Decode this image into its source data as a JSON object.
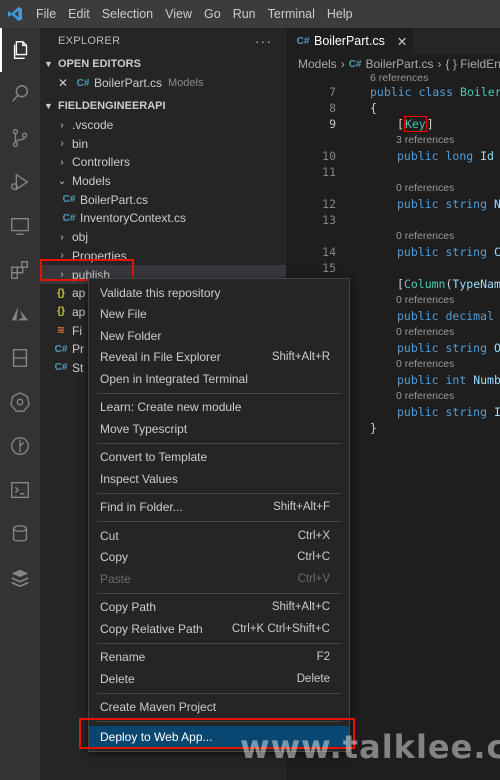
{
  "menu": [
    "File",
    "Edit",
    "Selection",
    "View",
    "Go",
    "Run",
    "Terminal",
    "Help"
  ],
  "activity_icons": [
    "files-icon",
    "search-icon",
    "source-control-icon",
    "run-debug-icon",
    "remote-explorer-icon",
    "extensions-icon",
    "azure-icon",
    "bookmark-icon",
    "kubernetes-icon",
    "git-graph-icon",
    "terminal-icon",
    "database-icon",
    "stack-icon"
  ],
  "explorer": {
    "title": "EXPLORER",
    "more": "···",
    "open_editors_label": "OPEN EDITORS",
    "open_editor": {
      "name": "BoilerPart.cs",
      "folder": "Models"
    },
    "project_label": "FIELDENGINEERAPI",
    "tree": [
      {
        "label": ".vscode",
        "kind": "folder"
      },
      {
        "label": "bin",
        "kind": "folder"
      },
      {
        "label": "Controllers",
        "kind": "folder"
      },
      {
        "label": "Models",
        "kind": "folder-open"
      },
      {
        "label": "BoilerPart.cs",
        "kind": "cs"
      },
      {
        "label": "InventoryContext.cs",
        "kind": "cs"
      },
      {
        "label": "obj",
        "kind": "folder"
      },
      {
        "label": "Properties",
        "kind": "folder"
      },
      {
        "label": "publish",
        "kind": "folder"
      },
      {
        "label": "ap",
        "kind": "json"
      },
      {
        "label": "ap",
        "kind": "json"
      },
      {
        "label": "Fi",
        "kind": "rss"
      },
      {
        "label": "Pr",
        "kind": "cs"
      },
      {
        "label": "St",
        "kind": "cs"
      }
    ]
  },
  "tab": {
    "label": "BoilerPart.cs",
    "close": "✕"
  },
  "breadcrumb": [
    "Models",
    "BoilerPart.cs",
    "{ } FieldEngi"
  ],
  "code": {
    "refs_top": "6 references",
    "lines": [
      {
        "n": "7",
        "kind": "class",
        "text": "public class BoilerP"
      },
      {
        "n": "8",
        "kind": "brace",
        "text": "{"
      },
      {
        "n": "9",
        "kind": "attr",
        "text": "[Key]"
      },
      {
        "refs": "3 references"
      },
      {
        "n": "10",
        "kind": "prop",
        "type": "long",
        "name": "Id {"
      },
      {
        "n": "11",
        "kind": "blank"
      },
      {
        "refs": "0 references"
      },
      {
        "n": "12",
        "kind": "prop",
        "type": "string",
        "name": "Na"
      },
      {
        "n": "13",
        "kind": "blank"
      },
      {
        "refs": "0 references"
      },
      {
        "n": "14",
        "kind": "prop",
        "type": "string",
        "name": "Ca"
      },
      {
        "n": "15",
        "kind": "blank"
      },
      {
        "n": "",
        "kind": "attr2",
        "text": "[Column(TypeName"
      },
      {
        "refs": "0 references"
      },
      {
        "n": "",
        "kind": "prop",
        "type": "decimal",
        "name": "P"
      },
      {
        "refs": "0 references"
      },
      {
        "n": "",
        "kind": "prop",
        "type": "string",
        "name": "Ov"
      },
      {
        "refs": "0 references"
      },
      {
        "n": "",
        "kind": "prop",
        "type": "int",
        "name": "Numbe"
      },
      {
        "refs": "0 references"
      },
      {
        "n": "",
        "kind": "prop",
        "type": "string",
        "name": "Im"
      },
      {
        "n": "",
        "kind": "close",
        "text": "}"
      }
    ]
  },
  "context_menu": {
    "groups": [
      [
        {
          "label": "Validate this repository",
          "kb": ""
        },
        {
          "label": "New File",
          "kb": ""
        },
        {
          "label": "New Folder",
          "kb": ""
        },
        {
          "label": "Reveal in File Explorer",
          "kb": "Shift+Alt+R"
        },
        {
          "label": "Open in Integrated Terminal",
          "kb": ""
        }
      ],
      [
        {
          "label": "Learn: Create new module",
          "kb": ""
        },
        {
          "label": "Move Typescript",
          "kb": ""
        }
      ],
      [
        {
          "label": "Convert to Template",
          "kb": ""
        },
        {
          "label": "Inspect Values",
          "kb": ""
        }
      ],
      [
        {
          "label": "Find in Folder...",
          "kb": "Shift+Alt+F"
        }
      ],
      [
        {
          "label": "Cut",
          "kb": "Ctrl+X"
        },
        {
          "label": "Copy",
          "kb": "Ctrl+C"
        },
        {
          "label": "Paste",
          "kb": "Ctrl+V",
          "disabled": true
        }
      ],
      [
        {
          "label": "Copy Path",
          "kb": "Shift+Alt+C"
        },
        {
          "label": "Copy Relative Path",
          "kb": "Ctrl+K Ctrl+Shift+C"
        }
      ],
      [
        {
          "label": "Rename",
          "kb": "F2"
        },
        {
          "label": "Delete",
          "kb": "Delete"
        }
      ],
      [
        {
          "label": "Create Maven Project",
          "kb": ""
        }
      ],
      [
        {
          "label": "Deploy to Web App...",
          "kb": "",
          "highlighted": true
        }
      ]
    ]
  },
  "watermark": "www.talklee.com",
  "colors": {
    "highlight": "#094771",
    "annotation_red": "#e51400",
    "keyword": "#569cd6",
    "identifier": "#9cdcfe",
    "type": "#4ec9b0"
  }
}
